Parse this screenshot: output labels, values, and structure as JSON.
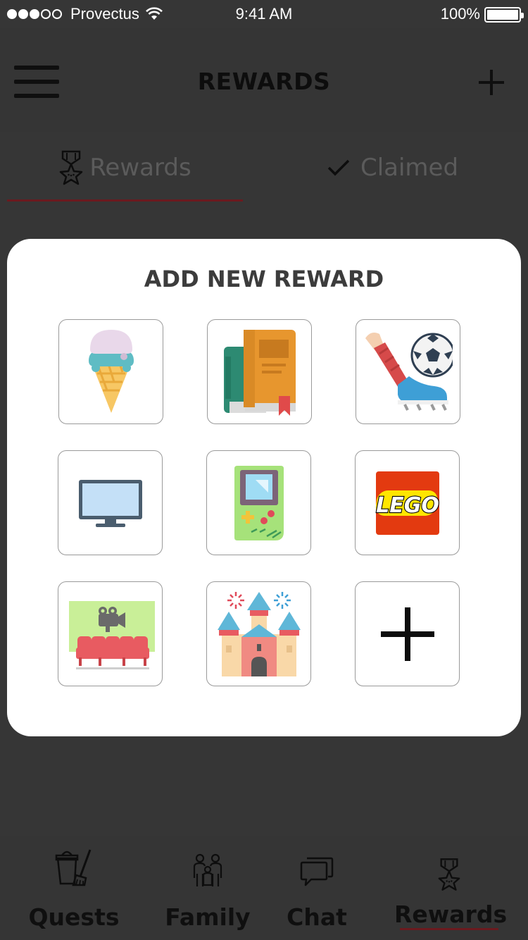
{
  "status_bar": {
    "carrier": "Provectus",
    "time": "9:41 AM",
    "battery": "100%"
  },
  "header": {
    "title": "REWARDS"
  },
  "tabs": [
    {
      "label": "Rewards",
      "icon": "medal-icon",
      "selected": true
    },
    {
      "label": "Claimed",
      "icon": "checkmark-icon",
      "selected": false
    }
  ],
  "modal": {
    "title": "ADD NEW REWARD",
    "options": [
      {
        "icon": "ice-cream-icon"
      },
      {
        "icon": "books-icon"
      },
      {
        "icon": "soccer-icon"
      },
      {
        "icon": "tv-icon"
      },
      {
        "icon": "game-console-icon"
      },
      {
        "icon": "lego-logo",
        "logo_text": "LEGO"
      },
      {
        "icon": "cinema-icon"
      },
      {
        "icon": "castle-icon"
      },
      {
        "icon": "plus-icon"
      }
    ]
  },
  "bottom_nav": [
    {
      "label": "Quests",
      "icon": "bucket-broom-icon",
      "selected": false
    },
    {
      "label": "Family",
      "icon": "family-icon",
      "selected": false
    },
    {
      "label": "Chat",
      "icon": "chat-bubbles-icon",
      "selected": false
    },
    {
      "label": "Rewards",
      "icon": "medal-icon",
      "selected": true
    }
  ],
  "colors": {
    "background": "#363636",
    "accent_underline": "#6b1a1f",
    "modal": "#ffffff"
  }
}
